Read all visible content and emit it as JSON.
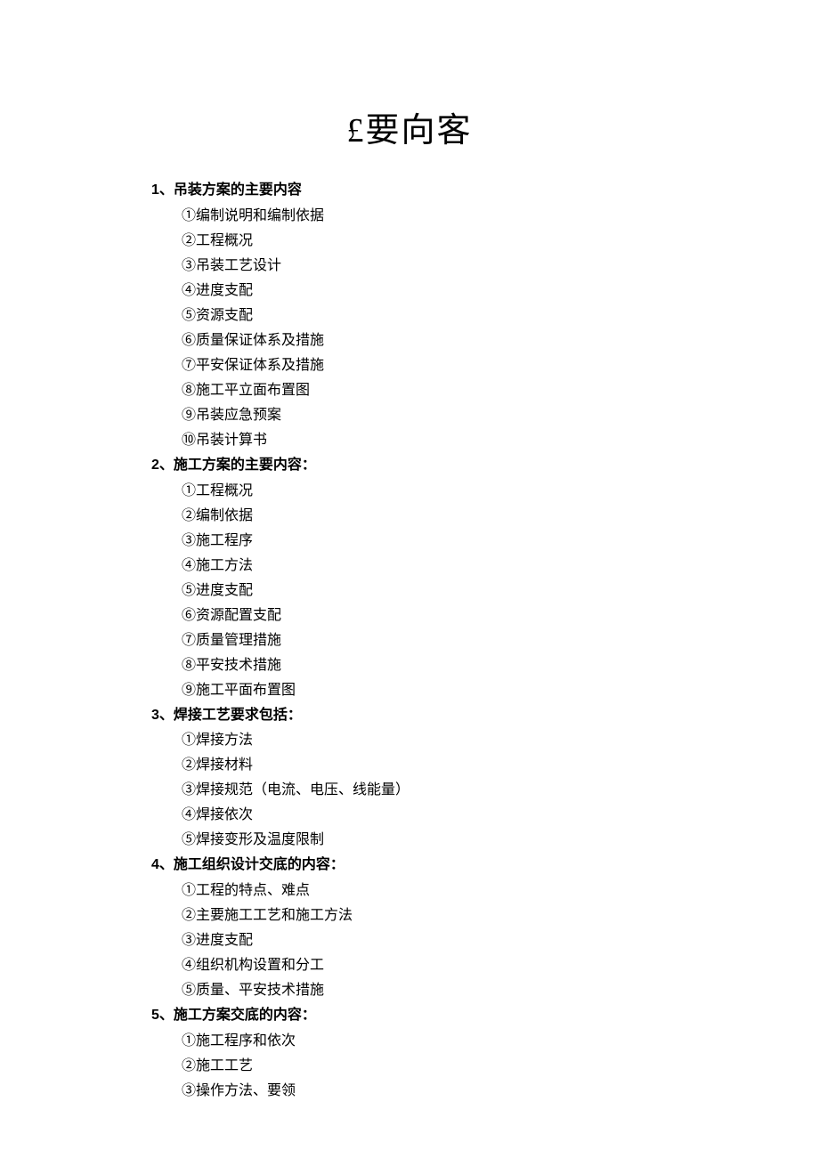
{
  "title": "£要向客",
  "sections": [
    {
      "heading": "1、吊装方案的主要内容",
      "items": [
        "①编制说明和编制依据",
        "②工程概况",
        "③吊装工艺设计",
        "④进度支配",
        "⑤资源支配",
        "⑥质量保证体系及措施",
        "⑦平安保证体系及措施",
        "⑧施工平立面布置图",
        "⑨吊装应急预案",
        "⑩吊装计算书"
      ]
    },
    {
      "heading": "2、施工方案的主要内容：",
      "items": [
        "①工程概况",
        "②编制依据",
        "③施工程序",
        "④施工方法",
        "⑤进度支配",
        "⑥资源配置支配",
        "⑦质量管理措施",
        "⑧平安技术措施",
        "⑨施工平面布置图"
      ]
    },
    {
      "heading": "3、焊接工艺要求包括：",
      "items": [
        "①焊接方法",
        "②焊接材料",
        "③焊接规范（电流、电压、线能量）",
        "④焊接依次",
        "⑤焊接变形及温度限制"
      ]
    },
    {
      "heading": "4、施工组织设计交底的内容：",
      "items": [
        "①工程的特点、难点",
        "②主要施工工艺和施工方法",
        "③进度支配",
        "④组织机构设置和分工",
        "⑤质量、平安技术措施"
      ]
    },
    {
      "heading": "5、施工方案交底的内容：",
      "items": [
        "①施工程序和依次",
        "②施工工艺",
        "③操作方法、要领"
      ]
    }
  ]
}
